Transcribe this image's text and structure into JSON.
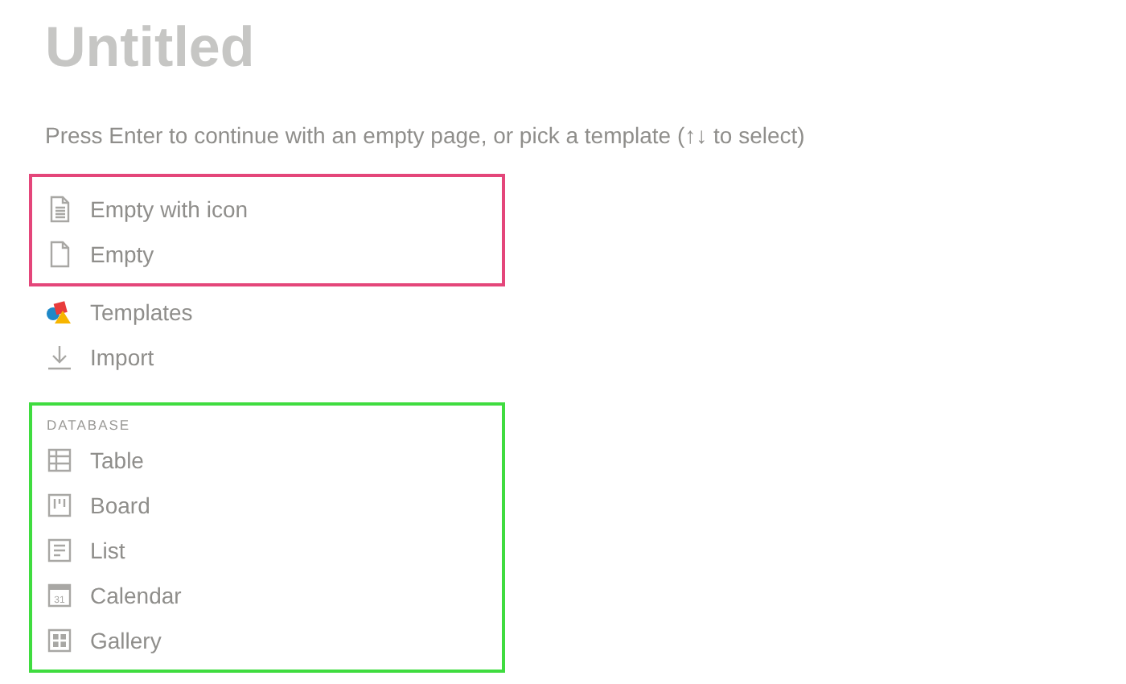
{
  "title": "Untitled",
  "hint": "Press Enter to continue with an empty page, or pick a template (↑↓ to select)",
  "sections": [
    {
      "color": "#e4467a",
      "items": [
        {
          "label": "Empty with icon",
          "kind": "document"
        },
        {
          "label": "Empty",
          "kind": "page"
        }
      ]
    },
    {
      "items": [
        {
          "label": "Templates",
          "kind": "shapes"
        },
        {
          "label": "Import",
          "kind": "download"
        }
      ]
    },
    {
      "color": "#3fdc3f",
      "heading": "DATABASE",
      "items": [
        {
          "label": "Table",
          "kind": "table"
        },
        {
          "label": "Board",
          "kind": "board"
        },
        {
          "label": "List",
          "kind": "list"
        },
        {
          "label": "Calendar",
          "kind": "calendar",
          "icon_text": "31"
        },
        {
          "label": "Gallery",
          "kind": "gallery"
        }
      ]
    }
  ]
}
